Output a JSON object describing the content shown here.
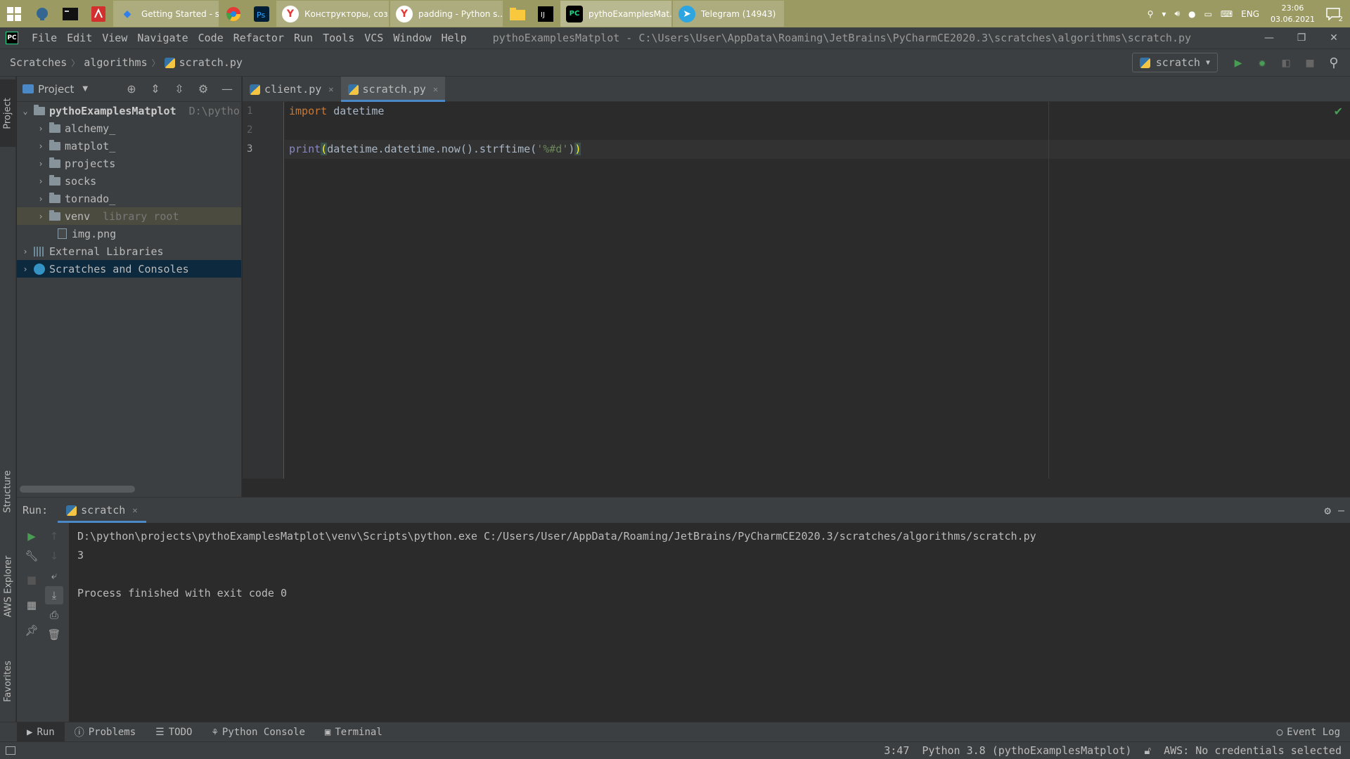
{
  "taskbar": {
    "buttons": [
      {
        "label": "Getting Started - sq...",
        "icon": "vscode-icon",
        "color": "#2f80ed"
      },
      {
        "label": "Конструкторы, соз...",
        "icon": "yandex-browser-icon",
        "color": "#e53935"
      },
      {
        "label": "padding - Python s...",
        "icon": "yandex-browser-icon",
        "color": "#e53935"
      },
      {
        "label": "pythoExamplesMat...",
        "icon": "pycharm-icon",
        "color": "#21d789"
      },
      {
        "label": "Telegram (14943)",
        "icon": "telegram-icon",
        "color": "#2ca5e0"
      }
    ],
    "tray": {
      "lang": "ENG",
      "time": "23:06",
      "date": "03.06.2021",
      "notifications": "2"
    }
  },
  "menubar": {
    "items": [
      "File",
      "Edit",
      "View",
      "Navigate",
      "Code",
      "Refactor",
      "Run",
      "Tools",
      "VCS",
      "Window",
      "Help"
    ],
    "window_title": "pythoExamplesMatplot - C:\\Users\\User\\AppData\\Roaming\\JetBrains\\PyCharmCE2020.3\\scratches\\algorithms\\scratch.py"
  },
  "navbar": {
    "crumbs": [
      "Scratches",
      "algorithms",
      "scratch.py"
    ],
    "run_config": "scratch"
  },
  "left_strip": {
    "project": "Project",
    "structure": "Structure",
    "aws": "AWS Explorer",
    "favorites": "Favorites"
  },
  "project_panel": {
    "title": "Project",
    "root": {
      "name": "pythoExamplesMatplot",
      "path": "D:\\pytho"
    },
    "folders": [
      "alchemy_",
      "matplot_",
      "projects",
      "socks",
      "tornado_"
    ],
    "venv": {
      "name": "venv",
      "hint": "library root"
    },
    "file": "img.png",
    "external": "External Libraries",
    "scratches": "Scratches and Consoles"
  },
  "editor": {
    "tabs": [
      {
        "label": "client.py"
      },
      {
        "label": "scratch.py"
      }
    ],
    "line_numbers": [
      "1",
      "2",
      "3"
    ],
    "code": {
      "l1_kw": "import",
      "l1_rest": " datetime",
      "l3_fn": "print",
      "l3_open": "(",
      "l3_mid": "datetime.datetime.now().strftime(",
      "l3_str": "'%#d'",
      "l3_end": ")",
      "l3_close": ")"
    }
  },
  "run_panel": {
    "label": "Run:",
    "tab": "scratch",
    "output": [
      "D:\\python\\projects\\pythoExamplesMatplot\\venv\\Scripts\\python.exe C:/Users/User/AppData/Roaming/JetBrains/PyCharmCE2020.3/scratches/algorithms/scratch.py",
      "3",
      "",
      "Process finished with exit code 0"
    ]
  },
  "bottom_tools": {
    "run": "Run",
    "problems": "Problems",
    "todo": "TODO",
    "python_console": "Python Console",
    "terminal": "Terminal",
    "event_log": "Event Log"
  },
  "status_bar": {
    "position": "3:47",
    "interpreter": "Python 3.8 (pythoExamplesMatplot)",
    "aws": "AWS: No credentials selected"
  }
}
